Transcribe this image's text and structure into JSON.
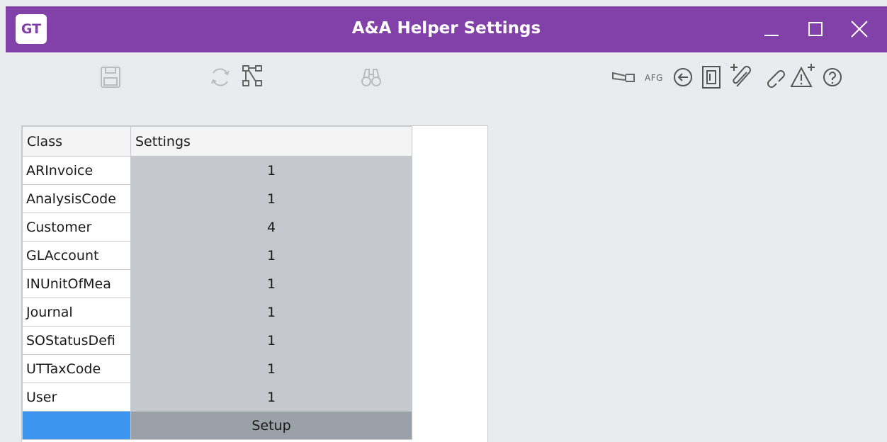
{
  "window": {
    "logo_text": "GT",
    "title": "A&A Helper Settings"
  },
  "toolbar": {
    "left_icons": [
      "save-icon",
      "refresh-icon",
      "network-icon",
      "binoculars-icon"
    ],
    "afg_label": "AFG",
    "right_icons": [
      "flashlight-icon",
      "back-arrow-icon",
      "document-icon",
      "paperclip-add-icon",
      "link-icon",
      "warning-add-icon",
      "help-icon"
    ]
  },
  "grid": {
    "headers": {
      "class": "Class",
      "settings": "Settings"
    },
    "rows": [
      {
        "class": "ARInvoice",
        "count": "1"
      },
      {
        "class": "AnalysisCode",
        "count": "1"
      },
      {
        "class": "Customer",
        "count": "4"
      },
      {
        "class": "GLAccount",
        "count": "1"
      },
      {
        "class": "INUnitOfMea",
        "count": "1"
      },
      {
        "class": "Journal",
        "count": "1"
      },
      {
        "class": "SOStatusDefi",
        "count": "1"
      },
      {
        "class": "UTTaxCode",
        "count": "1"
      },
      {
        "class": "User",
        "count": "1"
      }
    ],
    "footer_button": "Setup"
  },
  "colors": {
    "titlebar": "#8241a8",
    "selection": "#3c96f0",
    "cell": "#c5c9ce",
    "setup": "#9aa1a9"
  }
}
